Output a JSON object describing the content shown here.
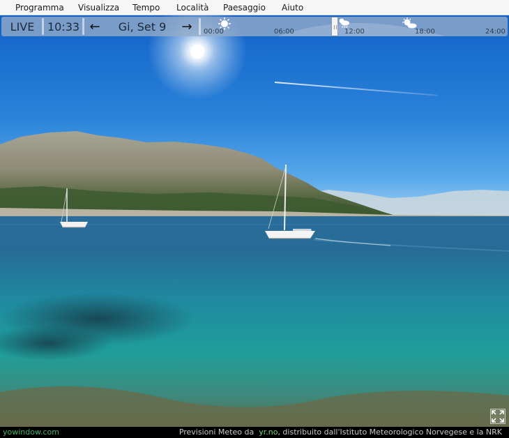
{
  "menu": {
    "items": [
      "Programma",
      "Visualizza",
      "Tempo",
      "Località",
      "Paesaggio",
      "Aiuto"
    ]
  },
  "timeline": {
    "live_label": "LIVE",
    "time": "10:33",
    "date": "Gi, Set 9",
    "prev_icon": "arrow-left-icon",
    "next_icon": "arrow-right-icon",
    "ticks": [
      "00:00",
      "06:00",
      "12:00",
      "18:00",
      "24:00"
    ],
    "weather_icons": [
      "sunny-icon",
      "sun-cloud-rain-icon",
      "partly-cloudy-icon"
    ]
  },
  "status": {
    "brand": "yowindow.com",
    "credit_prefix": "Previsioni Meteo da  ",
    "credit_link": "yr.no",
    "credit_suffix": ", distribuito dall'Istituto Meteorologico Norvegese e la NRK"
  },
  "colors": {
    "sky_top": "#1162c7",
    "sea": "#1f6f9a",
    "brand_green": "#3fb26a"
  }
}
